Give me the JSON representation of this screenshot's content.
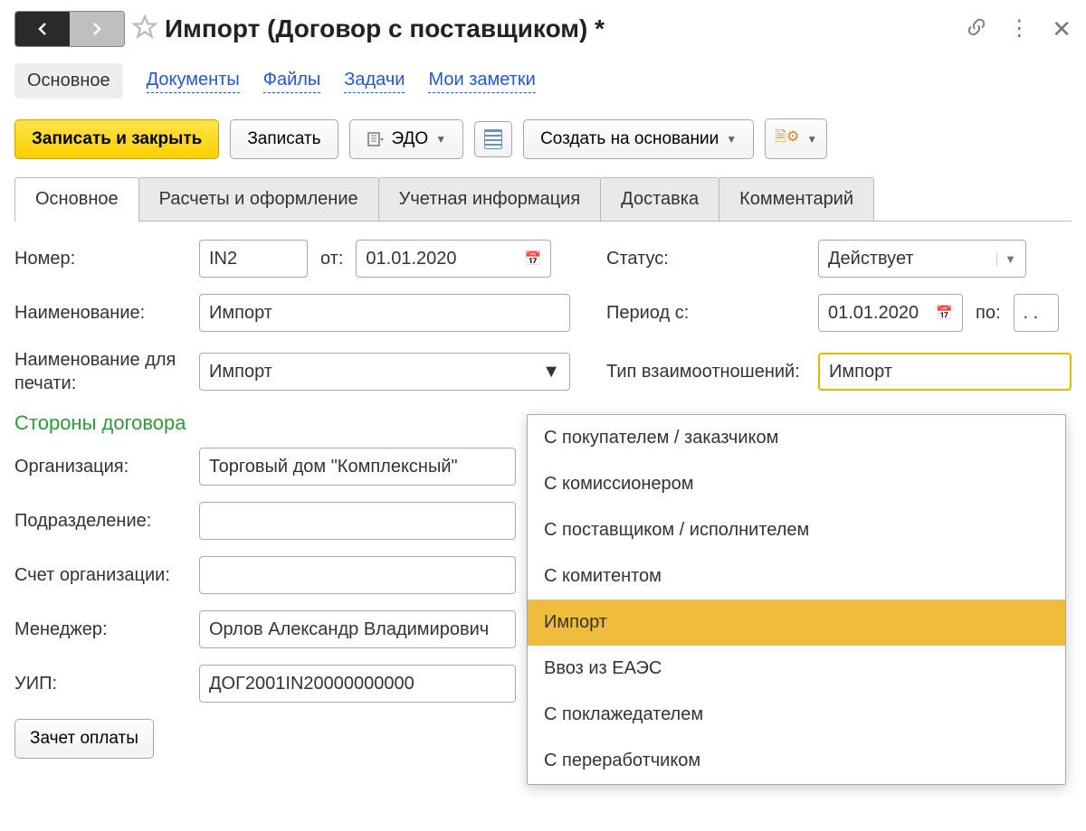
{
  "title": "Импорт (Договор с поставщиком) *",
  "nav": {
    "items": [
      "Основное",
      "Документы",
      "Файлы",
      "Задачи",
      "Мои заметки"
    ],
    "active_index": 0
  },
  "toolbar": {
    "save_close": "Записать и закрыть",
    "save": "Записать",
    "edo": "ЭДО",
    "create_based": "Создать на основании"
  },
  "tabs": {
    "items": [
      "Основное",
      "Расчеты и оформление",
      "Учетная информация",
      "Доставка",
      "Комментарий"
    ],
    "active_index": 0
  },
  "form": {
    "labels": {
      "number": "Номер:",
      "from": "от:",
      "status": "Статус:",
      "name": "Наименование:",
      "period_from": "Период с:",
      "to": "по:",
      "name_print": "Наименование для печати:",
      "relation_type": "Тип взаимоотношений:",
      "section_parties": "Стороны договора",
      "org": "Организация:",
      "department": "Подразделение:",
      "account": "Счет организации:",
      "manager": "Менеджер:",
      "uip": "УИП:",
      "offset": "Зачет оплаты"
    },
    "values": {
      "number": "IN2",
      "date": "01.01.2020",
      "status": "Действует",
      "name": "Импорт",
      "period_from": "01.01.2020",
      "period_to": " .  .    ",
      "name_print": "Импорт",
      "relation_type_value": "Импорт",
      "org": "Торговый дом \"Комплексный\"",
      "department": "",
      "account": "",
      "manager": "Орлов Александр Владимирович",
      "uip": "ДОГ2001IN20000000000"
    }
  },
  "dropdown": {
    "options": [
      "С покупателем / заказчиком",
      "С комиссионером",
      "С поставщиком / исполнителем",
      "С комитентом",
      "Импорт",
      "Ввоз из ЕАЭС",
      "С поклажедателем",
      "С переработчиком"
    ],
    "selected_index": 4
  }
}
